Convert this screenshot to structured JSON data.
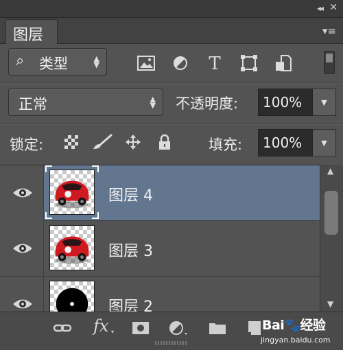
{
  "panel": {
    "collapse_glyph": "◂◂",
    "close_glyph": "✕",
    "tab_label": "图层",
    "menu_glyph": "▾≡"
  },
  "filter": {
    "search_glyph": "⌕",
    "kind_label": "类型",
    "icons": [
      "pixel-filter-icon",
      "adjustment-filter-icon",
      "type-filter-icon",
      "shape-filter-icon",
      "smart-object-filter-icon"
    ],
    "type_glyph": "T"
  },
  "blend": {
    "mode": "正常",
    "opacity_label": "不透明度:",
    "opacity_value": "100%"
  },
  "lock": {
    "label": "锁定:",
    "fill_label": "填充:",
    "fill_value": "100%"
  },
  "layers": [
    {
      "name": "图层 4",
      "selected": true,
      "visible": true,
      "thumb": "red-car"
    },
    {
      "name": "图层 3",
      "selected": false,
      "visible": true,
      "thumb": "red-car"
    },
    {
      "name": "图层 2",
      "selected": false,
      "visible": true,
      "thumb": "black-circle"
    }
  ],
  "footer": {
    "fx_label": "fx",
    "icons": [
      "link-layers-icon",
      "add-style-icon",
      "add-mask-icon",
      "new-adjustment-icon",
      "new-group-icon",
      "new-layer-icon",
      "delete-layer-icon"
    ]
  },
  "watermark": {
    "logo": "Bai🐾经验",
    "url": "jingyan.baidu.com"
  },
  "colors": {
    "panel_bg": "#535353",
    "selected_row": "#637690",
    "field_bg": "#2b2b2b",
    "car_red": "#d01a22"
  }
}
